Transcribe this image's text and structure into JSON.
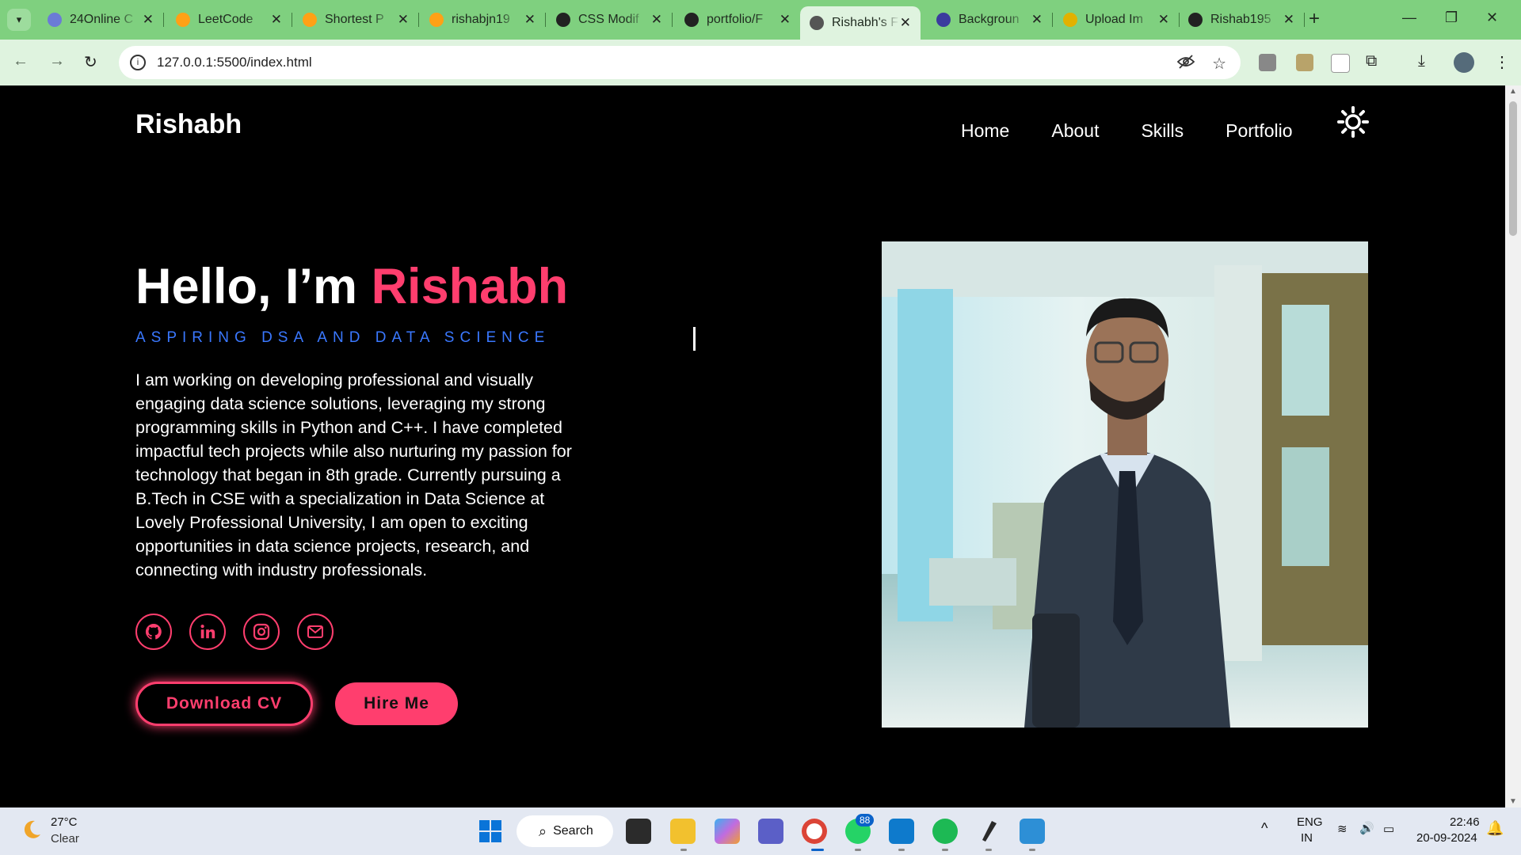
{
  "browser": {
    "tabs": [
      {
        "label": "24Online C",
        "icon": "24online-icon",
        "color": "#6b7bd6"
      },
      {
        "label": "LeetCode",
        "icon": "leetcode-icon",
        "color": "#ffa116"
      },
      {
        "label": "Shortest P",
        "icon": "leetcode-icon",
        "color": "#ffa116"
      },
      {
        "label": "rishabjn19",
        "icon": "leetcode-icon",
        "color": "#ffa116"
      },
      {
        "label": "CSS Modif",
        "icon": "openai-icon",
        "color": "#222222"
      },
      {
        "label": "portfolio/F",
        "icon": "github-icon",
        "color": "#222222"
      },
      {
        "label": "Rishabh's F",
        "icon": "globe-icon",
        "color": "#555555"
      },
      {
        "label": "Backgroun",
        "icon": "p-icon",
        "color": "#3b3b9e"
      },
      {
        "label": "Upload Im",
        "icon": "upload-icon",
        "color": "#e2b100"
      },
      {
        "label": "Rishab195",
        "icon": "github-icon",
        "color": "#222222"
      }
    ],
    "active_tab_index": 6,
    "new_tab": "+",
    "url": "127.0.0.1:5500/index.html"
  },
  "site": {
    "logo": "Rishabh",
    "nav": [
      "Home",
      "About",
      "Skills",
      "Portfolio"
    ],
    "hero": {
      "greeting": "Hello, I’m ",
      "name": "Rishabh",
      "tagline": "ASPIRING DSA AND DATA SCIENCE",
      "bio": "I am working on developing professional and visually engaging data science solutions, leveraging my strong programming skills in Python and C++. I have completed impactful tech projects while also nurturing my passion for technology that began in 8th grade. Currently pursuing a B.Tech in CSE with a specialization in Data Science at Lovely Professional University, I am open to exciting opportunities in data science projects, research, and connecting with industry professionals.",
      "socials": [
        "github-icon",
        "linkedin-icon",
        "instagram-icon",
        "mail-icon"
      ],
      "download_cv": "Download CV",
      "hire_me": "Hire Me"
    },
    "accent_color": "#ff3e6e",
    "tagline_color": "#3a78ff"
  },
  "taskbar": {
    "weather_temp": "27°C",
    "weather_cond": "Clear",
    "search": "Search",
    "whatsapp_badge": "88",
    "lang_line1": "ENG",
    "lang_line2": "IN",
    "time": "22:46",
    "date": "20-09-2024"
  }
}
